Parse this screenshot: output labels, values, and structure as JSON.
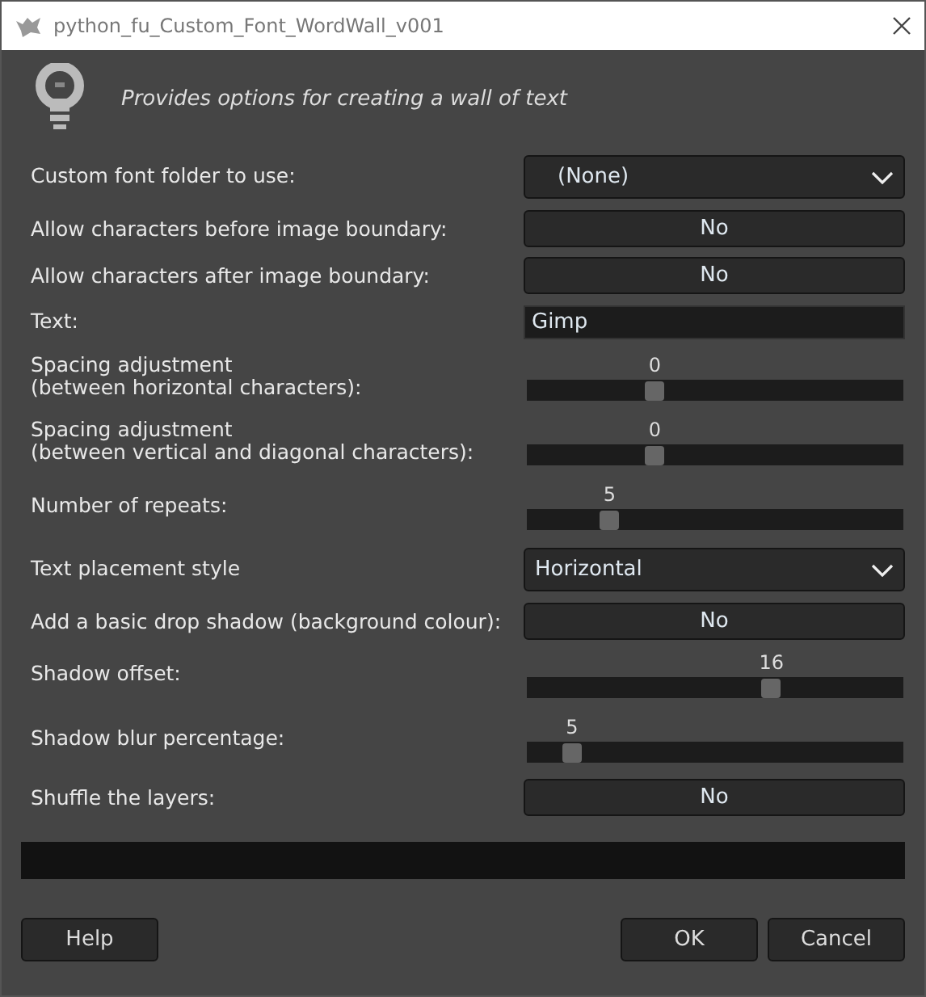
{
  "window": {
    "title": "python_fu_Custom_Font_WordWall_v001"
  },
  "description": "Provides options for creating a wall of text",
  "options": [
    {
      "kind": "combo",
      "label": "Custom font folder to use:",
      "value": "(None)"
    },
    {
      "kind": "toggle",
      "label": "Allow characters before image boundary:",
      "value": "No"
    },
    {
      "kind": "toggle",
      "label": "Allow characters after image boundary:",
      "value": "No"
    },
    {
      "kind": "entry",
      "label": "Text:",
      "value": "Gimp"
    },
    {
      "kind": "slider",
      "label": "Spacing adjustment\n(between horizontal characters):",
      "value": "0",
      "level": 0.34
    },
    {
      "kind": "slider",
      "label": "Spacing adjustment\n(between vertical and diagonal characters):",
      "value": "0",
      "level": 0.34
    },
    {
      "kind": "slider",
      "label": "Number of repeats:",
      "value": "5",
      "level": 0.22
    },
    {
      "kind": "combo",
      "label": "Text placement style",
      "value": "Horizontal"
    },
    {
      "kind": "toggle",
      "label": "Add a basic drop shadow (background colour):",
      "value": "No"
    },
    {
      "kind": "slider",
      "label": "Shadow offset:",
      "value": "16",
      "level": 0.65
    },
    {
      "kind": "slider",
      "label": "Shadow blur percentage:",
      "value": "5",
      "level": 0.12
    },
    {
      "kind": "toggle",
      "label": "Shuffle the layers:",
      "value": "No"
    }
  ],
  "buttons": [
    {
      "label": "Help"
    },
    {
      "label": "OK"
    },
    {
      "label": "Cancel"
    }
  ]
}
